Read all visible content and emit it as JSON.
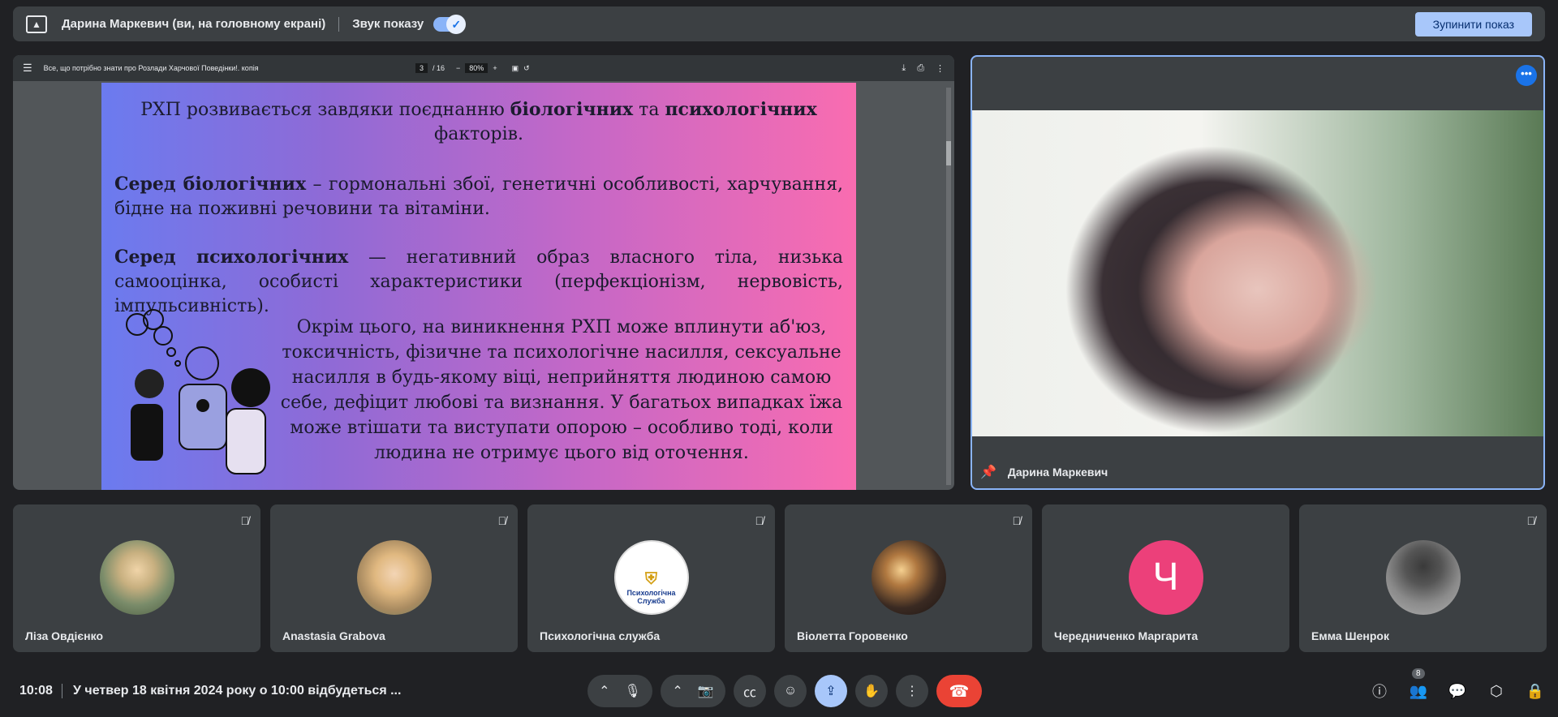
{
  "topbar": {
    "presenter_title": "Дарина Маркевич (ви, на головному екрані)",
    "sound_label": "Звук показу",
    "stop_button": "Зупинити показ"
  },
  "pdf": {
    "filename": "Все, що потрібно знати про Розлади Харчової Поведінки!. копія",
    "page_current": "3",
    "page_total": "/ 16",
    "zoom": "80%"
  },
  "slide": {
    "p1_a": "РХП розвивається завдяки поєднанню ",
    "p1_b": "біологічних",
    "p1_c": " та ",
    "p1_d": "психологічних",
    "p1_e": " факторів.",
    "p2_b": "Серед біологічних",
    "p2_rest": " – гормональні збої, генетичні особливості, харчування, бідне на поживні речовини та вітаміни.",
    "p3_b": "Серед психологічних",
    "p3_rest": " — негативний образ власного тіла, низька самооцінка, особисті характеристики (перфекціонізм, нервовість, імпульсивність).",
    "p4": "Окрім цього, на виникнення РХП може вплинути аб'юз, токсичність, фізичне та психологічне насилля, сексуальне насилля в будь-якому віці, неприйняття людиною самою себе, дефіцит любові та визнання. У багатьох випадках їжа може втішати та виступати опорою – особливо тоді, коли людина не отримує цього від оточення."
  },
  "speaker": {
    "name": "Дарина Маркевич"
  },
  "participants": [
    {
      "name": "Ліза Овдієнко",
      "avatar_color": "#8a9a78"
    },
    {
      "name": "Anastasia Grabova",
      "avatar_color": "#c9a67e"
    },
    {
      "name": "Психологічна служба",
      "logo_text": "Психологічна Служба"
    },
    {
      "name": "Віолетта Горовенко",
      "avatar_color": "#3a2a22"
    },
    {
      "name": "Чередниченко Маргарита",
      "letter": "Ч"
    },
    {
      "name": "Емма Шенрок",
      "avatar_color": "#7a7a7a"
    }
  ],
  "bottombar": {
    "time": "10:08",
    "meeting_title": "У четвер 18 квітня 2024 року о 10:00 відбудеться ...",
    "people_count": "8"
  },
  "colors": {
    "accent": "#8ab4f8",
    "hangup": "#ea4335",
    "letter_avatar": "#ec407a"
  }
}
